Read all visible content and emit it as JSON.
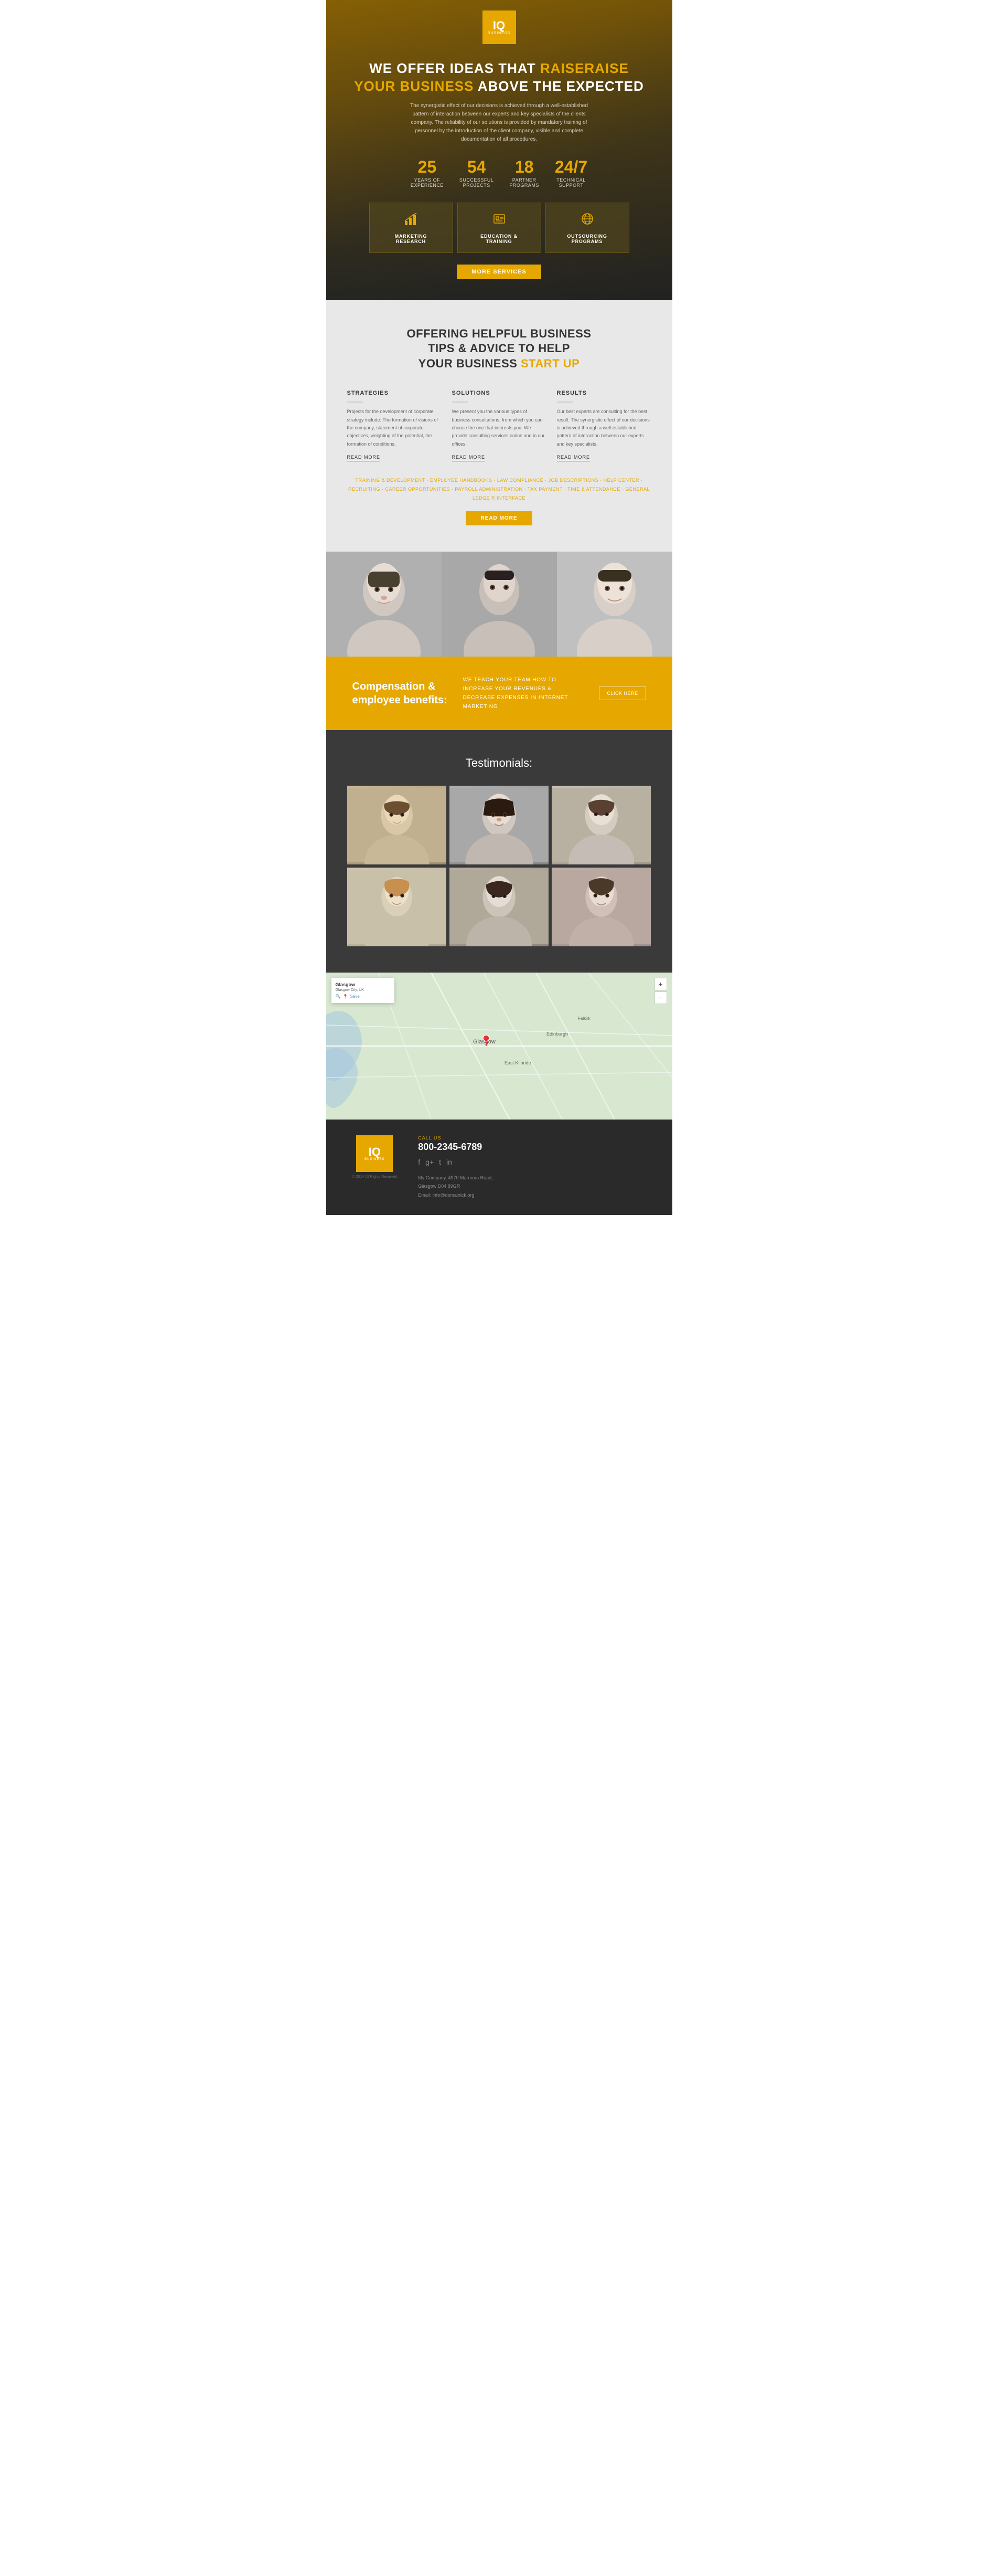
{
  "logo": {
    "iq": "IQ",
    "business": "business"
  },
  "hero": {
    "headline_line1": "WE OFFER IDEAS THAT",
    "headline_raise": "RAISE",
    "headline_line2": "YOUR BUSINESS",
    "headline_above": "ABOVE THE EXPECTED",
    "subtext": "The synergistic effect of our decisions is achieved through a well-established pattern of interaction between our experts and key specialists of the clients company. The reliability of our solutions is provided by mandatory training of personnel by the introduction of the client company, visible and complete documentation of all procedures.",
    "stats": [
      {
        "number": "25",
        "label": "years of\nexperience"
      },
      {
        "number": "54",
        "label": "successful\nprojects"
      },
      {
        "number": "18",
        "label": "partner\nprograms"
      },
      {
        "number": "24/7",
        "label": "technical\nsupport"
      }
    ],
    "services": [
      {
        "icon": "📊",
        "label": "MARKETING\nRESEARCH"
      },
      {
        "icon": "💼",
        "label": "EDUCATION &\nTRAINING"
      },
      {
        "icon": "🌐",
        "label": "OUTSOURCING\nPROGRAMS"
      }
    ],
    "more_services_btn": "more services"
  },
  "tips_section": {
    "headline_line1": "OFFERING HELPFUL BUSINESS",
    "headline_line2": "TIPS & ADVICE TO HELP",
    "headline_line3": "YOUR BUSINESS",
    "headline_startup": "START UP",
    "columns": [
      {
        "title": "STRATEGIES",
        "text": "Projects for the development of corporate strategy include: The formation of visions of the company, statement of corporate objectives, weighting of the potential, the formation of conditions.",
        "read_more": "read more"
      },
      {
        "title": "SOLUTIONS",
        "text": "We present you the various types of business consultations, from which you can choose the one that interests you. We provide consulting services online and in our offices.",
        "read_more": "read more"
      },
      {
        "title": "RESULTS",
        "text": "Our best experts are consulting for the best result. The synergistic effect of our decisions is achieved through a well-established pattern of interaction between our experts and key specialists.",
        "read_more": "read more"
      }
    ],
    "links": "TRAINING & DEVELOPMENT · EMPLOYEE HANDBOOKS · LAW COMPLIANCE · JOB DESCRIPTIONS · HELP CENTER · RECRUITING · CAREER OPPORTUNITIES · PAYROLL ADMINISTRATION · TAX PAYMENT · TIME & ATTENDANCE · GENERAL LEDGE R INTERFACE",
    "read_more_btn": "read more"
  },
  "compensation": {
    "title": "Compensation &\nemployee benefits:",
    "description": "WE TEACH YOUR TEAM HOW TO\nINCREASE YOUR REVENUES & DECREASE\nEXPENSES IN INTERNET MARKETING",
    "btn": "click here"
  },
  "testimonials": {
    "title": "Testimonials:",
    "photos": [
      {
        "id": 1
      },
      {
        "id": 2
      },
      {
        "id": 3
      },
      {
        "id": 4
      },
      {
        "id": 5
      },
      {
        "id": 6
      }
    ]
  },
  "map": {
    "overlay_title": "Glasgow",
    "overlay_subtitle": "Glasgow City, UK",
    "overlay_text": "Glasgow",
    "zoom_in": "+",
    "zoom_out": "−",
    "save": "Save"
  },
  "footer": {
    "logo_iq": "IQ",
    "logo_business": "business",
    "copyright": "© 2014 All Rights Reserved",
    "call_us": "CALL US",
    "phone": "800-2345-6789",
    "social_icons": [
      "f",
      "g+",
      "t",
      "in"
    ],
    "company": "My Company, 4970 Marmora Road,",
    "city": "Glasgow D04 89GR",
    "email": "Email: info@domainlck.org"
  }
}
